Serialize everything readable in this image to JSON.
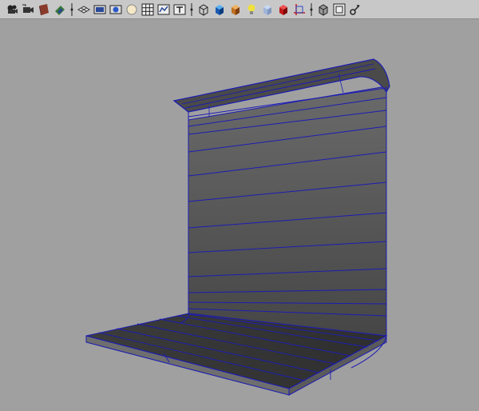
{
  "app": {
    "toolbar": {
      "buttons": [
        {
          "id": "camera-attrs",
          "icon": "camera-icon"
        },
        {
          "id": "camera-tools",
          "icon": "camera-select-icon"
        },
        {
          "id": "bookmarks",
          "icon": "book-icon"
        },
        {
          "id": "image-plane",
          "icon": "image-plane-icon"
        },
        {
          "id": "grid",
          "icon": "grid-icon"
        },
        {
          "id": "film-gate",
          "icon": "film-gate-icon"
        },
        {
          "id": "resolution-gate",
          "icon": "resolution-gate-icon"
        },
        {
          "id": "gate-mask",
          "icon": "gate-mask-icon"
        },
        {
          "id": "field-chart",
          "icon": "field-chart-icon"
        },
        {
          "id": "safe-action",
          "icon": "safe-action-icon"
        },
        {
          "id": "safe-title",
          "icon": "safe-title-icon"
        },
        {
          "id": "wireframe",
          "icon": "wireframe-cube-icon"
        },
        {
          "id": "smooth-shade",
          "icon": "smooth-shade-cube-icon"
        },
        {
          "id": "textured",
          "icon": "textured-cube-icon"
        },
        {
          "id": "use-default-light",
          "icon": "light-bulb-icon"
        },
        {
          "id": "shadows",
          "icon": "shadow-cube-icon"
        },
        {
          "id": "isolate-select",
          "icon": "isolate-cube-icon"
        },
        {
          "id": "xray",
          "icon": "xray-cube-icon"
        },
        {
          "id": "frame-selection",
          "icon": "frame-icon"
        },
        {
          "id": "wireframe-on-shaded",
          "icon": "wire-on-shaded-icon"
        },
        {
          "id": "film-gate-overscan",
          "icon": "overscan-icon"
        },
        {
          "id": "manipulator",
          "icon": "manipulator-icon"
        }
      ]
    },
    "viewport": {
      "wire_color": "#1c1cb4",
      "surface_color": "#5a5a5a"
    }
  }
}
